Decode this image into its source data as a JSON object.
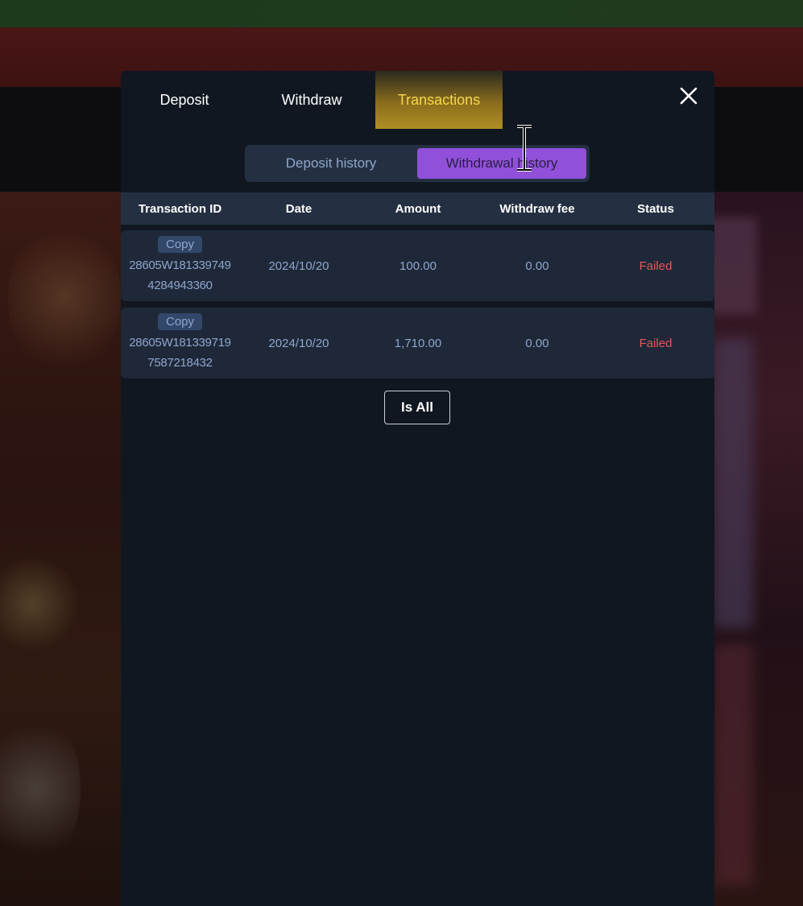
{
  "tabs": {
    "deposit": "Deposit",
    "withdraw": "Withdraw",
    "transactions": "Transactions",
    "active": "Transactions"
  },
  "close_icon": "close-icon",
  "subtabs": {
    "deposit_history": "Deposit history",
    "withdrawal_history": "Withdrawal history",
    "active": "Withdrawal history"
  },
  "table": {
    "headers": {
      "transaction_id": "Transaction ID",
      "date": "Date",
      "amount": "Amount",
      "withdraw_fee": "Withdraw fee",
      "status": "Status"
    },
    "rows": [
      {
        "copy_label": "Copy",
        "id_line1": "28605W181339749",
        "id_line2": "4284943360",
        "date": "2024/10/20",
        "amount": "100.00",
        "withdraw_fee": "0.00",
        "status": "Failed"
      },
      {
        "copy_label": "Copy",
        "id_line1": "28605W181339719",
        "id_line2": "7587218432",
        "date": "2024/10/20",
        "amount": "1,710.00",
        "withdraw_fee": "0.00",
        "status": "Failed"
      }
    ]
  },
  "footer_button": "Is All",
  "colors": {
    "modal_bg": "#111720",
    "active_tab_text": "#f6d64a",
    "active_subtab_bg": "#9150d9",
    "failed": "#e05a5a",
    "muted_text": "#8fa6cc"
  }
}
